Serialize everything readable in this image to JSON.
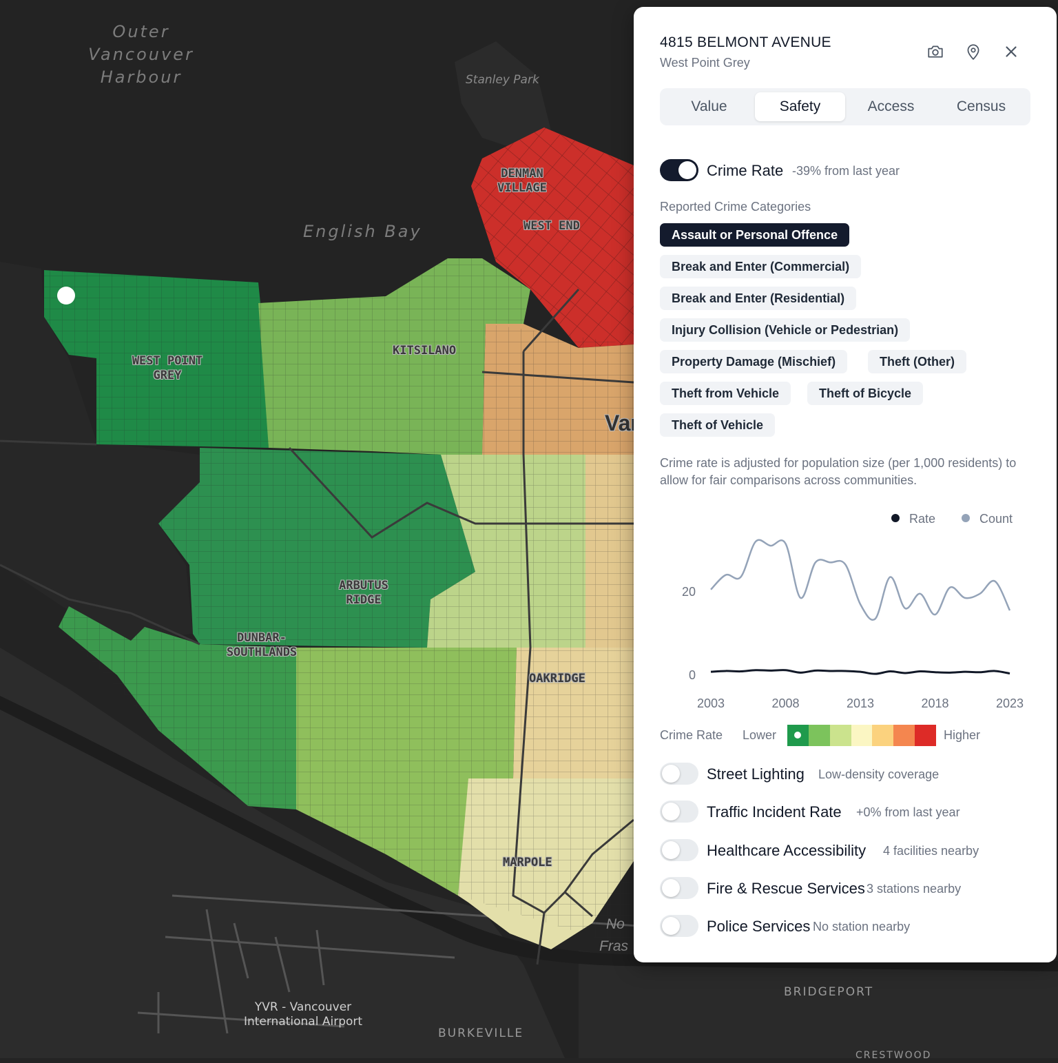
{
  "map": {
    "water_labels": [
      "Outer Vancouver Harbour",
      "English Bay"
    ],
    "park_label": "Stanley Park",
    "neighbourhood_labels": [
      "DENMAN VILLAGE",
      "WEST END",
      "KITSILANO",
      "WEST POINT GREY",
      "ARBUTUS RIDGE",
      "DUNBAR-SOUTHLANDS",
      "OAKRIDGE",
      "MARPOLE"
    ],
    "area_labels": [
      "YVR - Vancouver International Airport",
      "BURKEVILLE",
      "BRIDGEPORT",
      "CRESTWOOD"
    ],
    "partial_labels": [
      "Van",
      "No",
      "Fras"
    ],
    "colors": {
      "very_low": "#1f8a47",
      "low": "#3c9a4e",
      "low_mid": "#8fbf5c",
      "mid": "#bcd48a",
      "mid_high": "#e3d29a",
      "high": "#d9a56b",
      "highest": "#cc2f2a"
    }
  },
  "panel": {
    "title": "4815 BELMONT AVENUE",
    "subtitle": "West Point Grey",
    "icons": [
      "camera-icon",
      "location-pin-icon",
      "close-icon"
    ],
    "tabs": [
      "Value",
      "Safety",
      "Access",
      "Census"
    ],
    "active_tab": "Safety",
    "crime_rate": {
      "label": "Crime Rate",
      "change": "-39% from last year",
      "enabled": true
    },
    "categories_label": "Reported Crime Categories",
    "categories": [
      "Assault or Personal Offence",
      "Break and Enter (Commercial)",
      "Break and Enter (Residential)",
      "Injury Collision (Vehicle or Pedestrian)",
      "Property Damage (Mischief)",
      "Theft (Other)",
      "Theft from Vehicle",
      "Theft of Bicycle",
      "Theft of Vehicle"
    ],
    "active_category": "Assault or Personal Offence",
    "note": "Crime rate is adjusted for population size (per 1,000 residents) to allow for fair comparisons across communities.",
    "scale": {
      "label": "Crime Rate",
      "lower": "Lower",
      "higher": "Higher",
      "colors": [
        "#1f9a4c",
        "#7cc35c",
        "#cbe38d",
        "#fbf6c3",
        "#fbd27e",
        "#f4864f",
        "#dd2b27"
      ]
    },
    "layers": [
      {
        "name": "Street Lighting",
        "note": "Low-density coverage",
        "enabled": false
      },
      {
        "name": "Traffic Incident Rate",
        "note": "+0% from last year",
        "enabled": false
      },
      {
        "name": "Healthcare Accessibility",
        "note": "4 facilities nearby",
        "enabled": false
      },
      {
        "name": "Fire & Rescue Services",
        "note": "3 stations nearby",
        "enabled": false
      },
      {
        "name": "Police Services",
        "note": "No station nearby",
        "enabled": false
      }
    ]
  },
  "chart_data": {
    "type": "line",
    "x": [
      2003,
      2004,
      2005,
      2006,
      2007,
      2008,
      2009,
      2010,
      2011,
      2012,
      2013,
      2014,
      2015,
      2016,
      2017,
      2018,
      2019,
      2020,
      2021,
      2022,
      2023
    ],
    "series": [
      {
        "name": "Rate",
        "color": "#111827",
        "values": [
          0.8,
          1.0,
          0.9,
          1.2,
          1.1,
          1.2,
          0.6,
          1.1,
          1.0,
          1.0,
          0.8,
          0.3,
          0.9,
          0.5,
          0.9,
          0.7,
          0.6,
          0.8,
          0.7,
          1.0,
          0.4
        ]
      },
      {
        "name": "Count",
        "color": "#94a3b8",
        "values": [
          20.5,
          24,
          23.5,
          32,
          31,
          31.5,
          18.5,
          27,
          27,
          26.5,
          17,
          13.5,
          23.5,
          16,
          19.5,
          14.5,
          21,
          18.5,
          19.5,
          22.5,
          15.5
        ]
      }
    ],
    "xticks": [
      "2003",
      "2008",
      "2013",
      "2018",
      "2023"
    ],
    "yticks": [
      "0",
      "20"
    ],
    "ylim": [
      0,
      33
    ]
  }
}
